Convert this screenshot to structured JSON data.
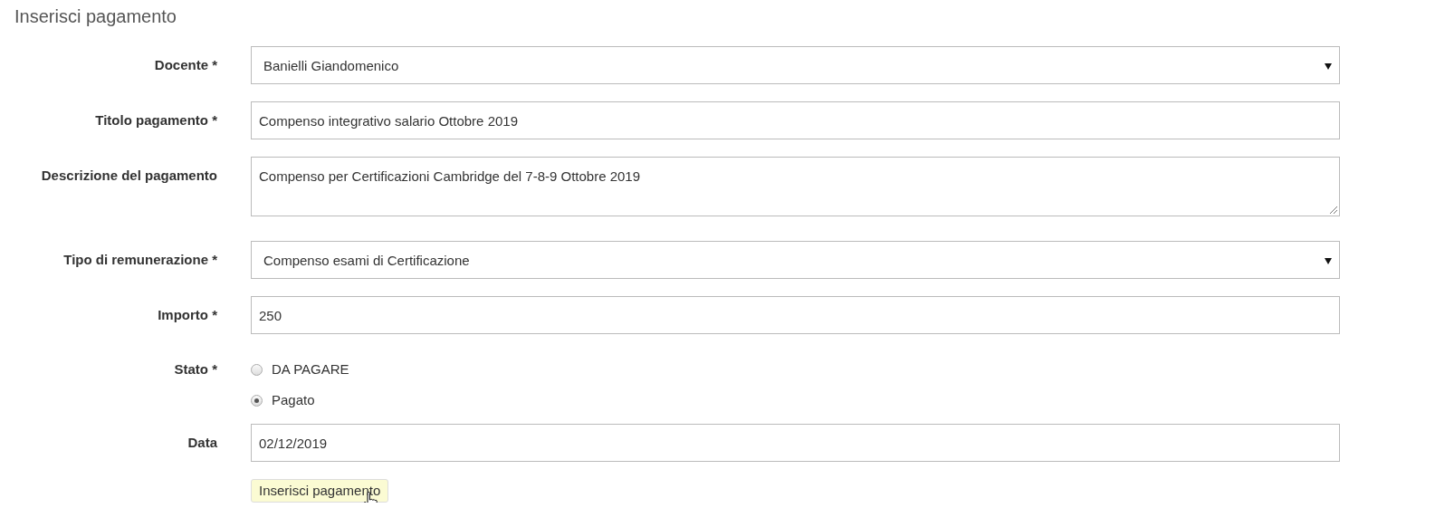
{
  "heading": "Inserisci pagamento",
  "fields": [
    {
      "kind": "select",
      "label": "Docente *",
      "value": "Banielli Giandomenico"
    },
    {
      "kind": "input",
      "label": "Titolo pagamento *",
      "value": "Compenso integrativo salario Ottobre 2019"
    },
    {
      "kind": "textarea",
      "label": "Descrizione del pagamento",
      "value": "Compenso per Certificazioni Cambridge del 7-8-9 Ottobre 2019"
    },
    {
      "kind": "select",
      "label": "Tipo di remunerazione *",
      "value": "Compenso esami di Certificazione"
    },
    {
      "kind": "input",
      "label": "Importo *",
      "value": "250"
    },
    {
      "kind": "radio",
      "label": "Stato *",
      "options": [
        {
          "label": "DA PAGARE",
          "selected": false
        },
        {
          "label": "Pagato",
          "selected": true
        }
      ]
    },
    {
      "kind": "input",
      "label": "Data",
      "value": "02/12/2019"
    }
  ],
  "submit_button": "Inserisci pagamento"
}
